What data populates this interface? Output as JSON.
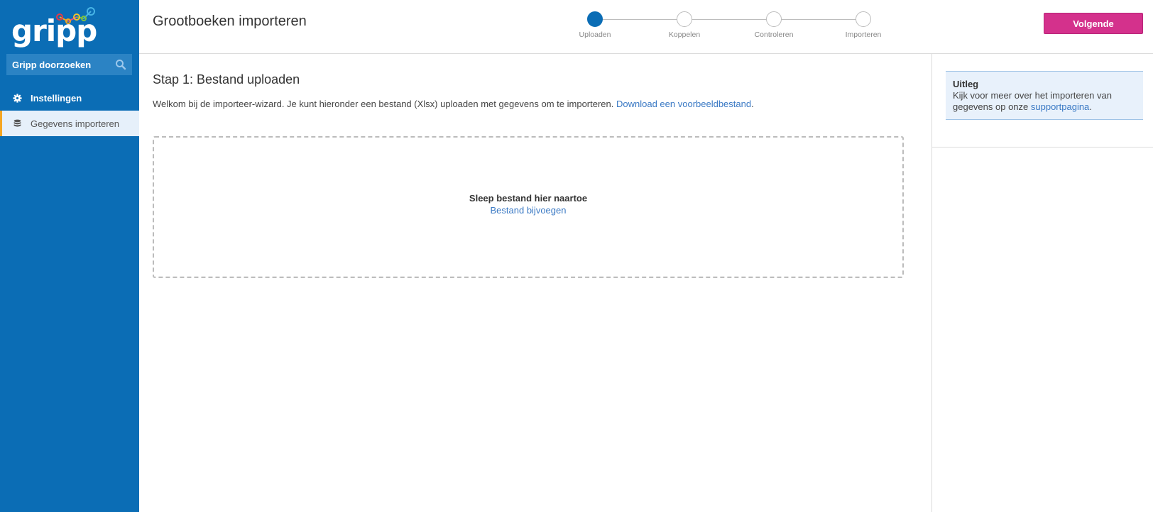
{
  "sidebar": {
    "logo_text": "gripp",
    "search_label": "Gripp doorzoeken",
    "items": [
      {
        "label": "Instellingen",
        "icon": "gear-icon"
      },
      {
        "label": "Gegevens importeren",
        "icon": "database-icon",
        "active": true
      }
    ]
  },
  "header": {
    "title": "Grootboeken importeren",
    "next_button": "Volgende",
    "steps": [
      {
        "label": "Uploaden",
        "active": true
      },
      {
        "label": "Koppelen",
        "active": false
      },
      {
        "label": "Controleren",
        "active": false
      },
      {
        "label": "Importeren",
        "active": false
      }
    ]
  },
  "main": {
    "step_title": "Stap 1: Bestand uploaden",
    "intro_text": "Welkom bij de importeer-wizard. Je kunt hieronder een bestand (Xlsx) uploaden met gegevens om te importeren.",
    "intro_link": "Download een voorbeeldbestand",
    "intro_end": ".",
    "dropzone": {
      "text": "Sleep bestand hier naartoe",
      "link": "Bestand bijvoegen"
    }
  },
  "info": {
    "title": "Uitleg",
    "text": "Kijk voor meer over het importeren van gegevens op onze",
    "link": "supportpagina",
    "end": "."
  },
  "colors": {
    "sidebar": "#0b6db5",
    "accent_button": "#d4318c",
    "link": "#3a79c4",
    "active_marker": "#f5a623"
  }
}
